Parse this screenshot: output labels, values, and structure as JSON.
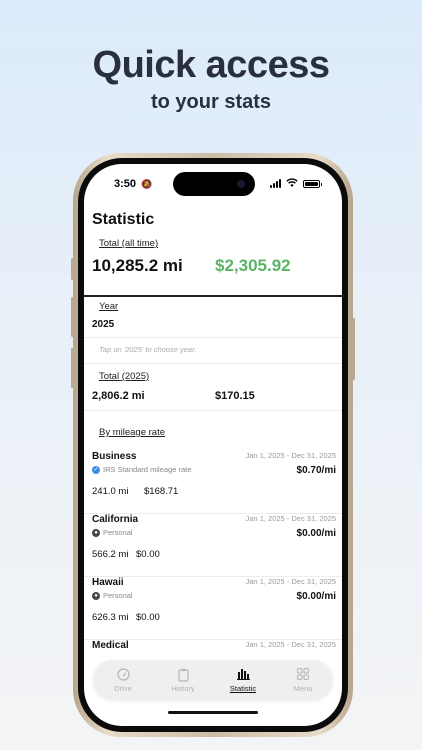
{
  "headline": "Quick access",
  "subheadline": "to your stats",
  "status_bar": {
    "time": "3:50"
  },
  "page_title": "Statistic",
  "total_all_time": {
    "label": "Total (all time)",
    "miles": "10,285.2 mi",
    "amount": "$2,305.92"
  },
  "year": {
    "label": "Year",
    "value": "2025",
    "hint": "Tap on '2025' to choose year."
  },
  "total_year": {
    "label": "Total (2025)",
    "miles": "2,806.2 mi",
    "amount": "$170.15"
  },
  "by_rate": {
    "label": "By mileage rate",
    "items": [
      {
        "name": "Business",
        "dates": "Jan 1, 2025 - Dec 31, 2025",
        "type": "IRS Standard mileage rate",
        "type_icon": "verified-icon",
        "rate": "$0.70/mi",
        "miles": "241.0 mi",
        "amount": "$168.71"
      },
      {
        "name": "California",
        "dates": "Jan 1, 2025 - Dec 31, 2025",
        "type": "Personal",
        "type_icon": "person-icon",
        "rate": "$0.00/mi",
        "miles": "566.2 mi",
        "amount": "$0.00"
      },
      {
        "name": "Hawaii",
        "dates": "Jan 1, 2025 - Dec 31, 2025",
        "type": "Personal",
        "type_icon": "person-icon",
        "rate": "$0.00/mi",
        "miles": "626.3 mi",
        "amount": "$0.00"
      },
      {
        "name": "Medical",
        "dates": "Jan 1, 2025 - Dec 31, 2025"
      }
    ]
  },
  "tabbar": {
    "items": [
      {
        "label": "Drive",
        "icon": "navigation-arrow-icon",
        "active": false
      },
      {
        "label": "History",
        "icon": "clipboard-icon",
        "active": false
      },
      {
        "label": "Statistic",
        "icon": "bar-chart-icon",
        "active": true
      },
      {
        "label": "Menu",
        "icon": "grid-icon",
        "active": false
      }
    ]
  },
  "colors": {
    "accent_green": "#5ab466",
    "verified_blue": "#3d8be6",
    "headline": "#2a2f3d"
  }
}
